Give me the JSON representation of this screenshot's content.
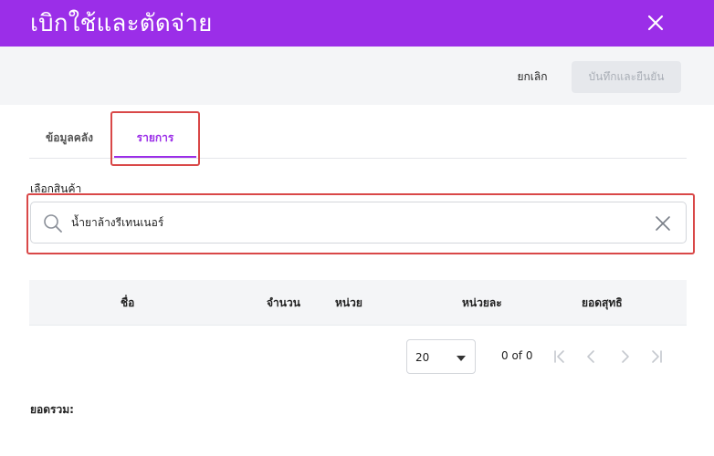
{
  "header": {
    "title": "เบิกใช้และตัดจ่าย"
  },
  "actions": {
    "cancel_label": "ยกเลิก",
    "confirm_label": "บันทึกและยืนยัน"
  },
  "tabs": [
    {
      "label": "ข้อมูลคลัง",
      "active": false
    },
    {
      "label": "รายการ",
      "active": true
    }
  ],
  "product_field": {
    "label": "เลือกสินค้า",
    "value": "น้ำยาล้างรีเทนเนอร์"
  },
  "table": {
    "columns": [
      "ชื่อ",
      "จำนวน",
      "หน่วย",
      "หน่วยละ",
      "ยอดสุทธิ"
    ],
    "rows": []
  },
  "pagination": {
    "page_size": "20",
    "count_text": "0 of 0"
  },
  "summary": {
    "total_label": "ยอดรวม:"
  },
  "colors": {
    "accent": "#9b2ee8",
    "highlight": "#d94848"
  }
}
